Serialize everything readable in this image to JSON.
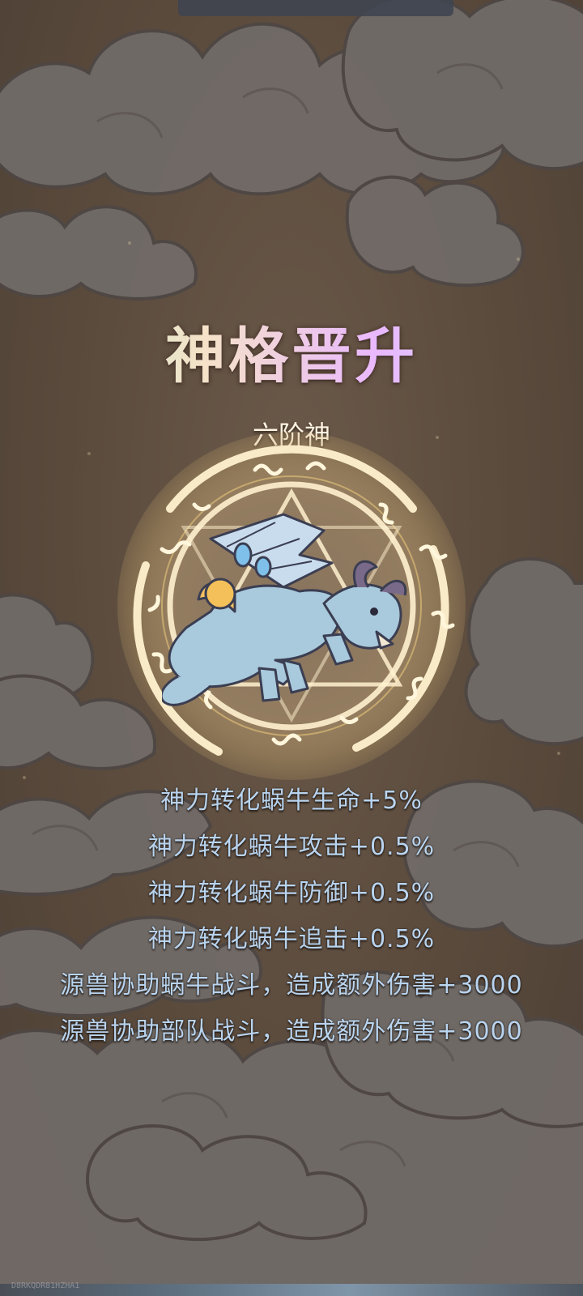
{
  "header": {
    "title": "神格晋升",
    "rank": "六阶神"
  },
  "effects": [
    "神力转化蜗牛生命+5%",
    "神力转化蜗牛攻击+0.5%",
    "神力转化蜗牛防御+0.5%",
    "神力转化蜗牛追击+0.5%",
    "源兽协助蜗牛战斗，造成额外伤害+3000",
    "源兽协助部队战斗，造成额外伤害+3000"
  ],
  "footer": {
    "watermark": "D8RKQDR81HZHA1"
  },
  "colors": {
    "background": "#5a4a3c",
    "cloud": "#706a67",
    "circle_glow": "#ffe7b0",
    "effect_text": "#b9d4ef",
    "beast_body": "#a9c9dc"
  },
  "icons": {
    "emblem": "magic-circle-icon",
    "beast": "dragon-beast-icon"
  }
}
